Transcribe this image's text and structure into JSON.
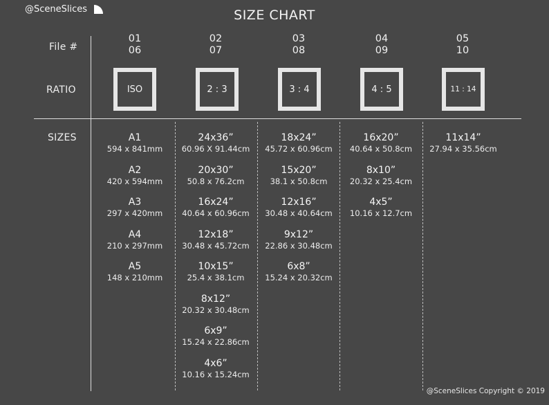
{
  "brand": {
    "handle": "@SceneSlices",
    "icon": "quarter-circle-icon"
  },
  "title": "SIZE CHART",
  "labels": {
    "file": "File #",
    "ratio": "RATIO",
    "sizes": "SIZES"
  },
  "columns": [
    {
      "files": [
        "01",
        "06"
      ],
      "ratio": "ISO",
      "sizes": [
        {
          "name": "A1",
          "dim": "594 x 841mm"
        },
        {
          "name": "A2",
          "dim": "420 x 594mm"
        },
        {
          "name": "A3",
          "dim": "297 x 420mm"
        },
        {
          "name": "A4",
          "dim": "210 x 297mm"
        },
        {
          "name": "A5",
          "dim": "148 x 210mm"
        }
      ]
    },
    {
      "files": [
        "02",
        "07"
      ],
      "ratio": "2 : 3",
      "sizes": [
        {
          "name": "24x36”",
          "dim": "60.96 X 91.44cm"
        },
        {
          "name": "20x30”",
          "dim": "50.8 x 76.2cm"
        },
        {
          "name": "16x24”",
          "dim": "40.64 x 60.96cm"
        },
        {
          "name": "12x18”",
          "dim": "30.48 x 45.72cm"
        },
        {
          "name": "10x15”",
          "dim": "25.4 x 38.1cm"
        },
        {
          "name": "8x12”",
          "dim": "20.32 x 30.48cm"
        },
        {
          "name": "6x9”",
          "dim": "15.24 x 22.86cm"
        },
        {
          "name": "4x6”",
          "dim": "10.16 x 15.24cm"
        }
      ]
    },
    {
      "files": [
        "03",
        "08"
      ],
      "ratio": "3 : 4",
      "sizes": [
        {
          "name": "18x24”",
          "dim": "45.72 x 60.96cm"
        },
        {
          "name": "15x20”",
          "dim": "38.1 x 50.8cm"
        },
        {
          "name": "12x16”",
          "dim": "30.48 x 40.64cm"
        },
        {
          "name": "9x12”",
          "dim": "22.86 x 30.48cm"
        },
        {
          "name": "6x8”",
          "dim": "15.24 x 20.32cm"
        }
      ]
    },
    {
      "files": [
        "04",
        "09"
      ],
      "ratio": "4 : 5",
      "sizes": [
        {
          "name": "16x20”",
          "dim": "40.64 x 50.8cm"
        },
        {
          "name": "8x10”",
          "dim": "20.32 x 25.4cm"
        },
        {
          "name": "4x5”",
          "dim": "10.16 x 12.7cm"
        }
      ]
    },
    {
      "files": [
        "05",
        "10"
      ],
      "ratio": "11 : 14",
      "sizes": [
        {
          "name": "11x14”",
          "dim": "27.94 x 35.56cm"
        }
      ]
    }
  ],
  "footer": "@SceneSlices Copyright © 2019"
}
